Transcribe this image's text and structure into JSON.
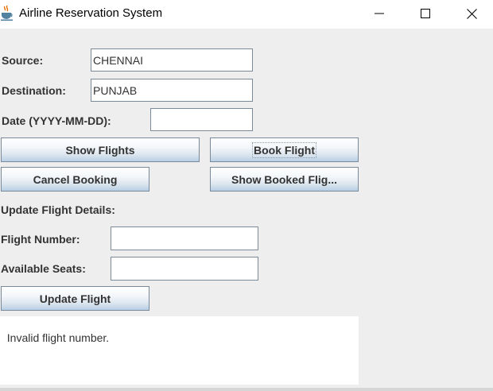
{
  "window": {
    "title": "Airline Reservation System",
    "icons": {
      "app": "java-cup-icon",
      "minimize": "minimize-icon",
      "maximize": "maximize-icon",
      "close": "close-icon"
    }
  },
  "form": {
    "source_label": "Source:",
    "source_value": "CHENNAI",
    "destination_label": "Destination:",
    "destination_value": "PUNJAB",
    "date_label": "Date (YYYY-MM-DD):",
    "date_value": ""
  },
  "buttons": {
    "show_flights": "Show Flights",
    "book_flight": "Book Flight",
    "cancel_booking": "Cancel Booking",
    "show_booked": "Show Booked Flig...",
    "update_flight": "Update Flight"
  },
  "update_section": {
    "heading": "Update Flight Details:",
    "flight_number_label": "Flight Number:",
    "flight_number_value": "",
    "available_seats_label": "Available Seats:",
    "available_seats_value": ""
  },
  "output": {
    "text": "Invalid flight number."
  },
  "colors": {
    "window_bg": "#eeeeee",
    "titlebar_bg": "#ffffff",
    "label_text": "#333333",
    "button_gradient_bottom": "#b8cfe5",
    "border": "#7a8a99"
  }
}
